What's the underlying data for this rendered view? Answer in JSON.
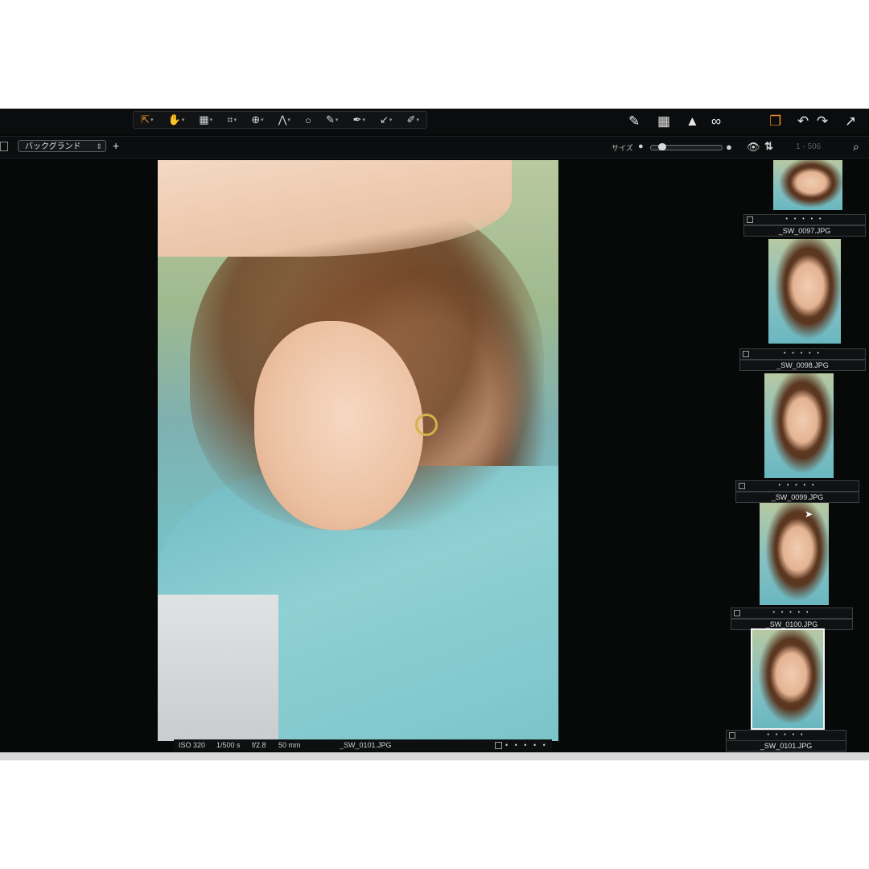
{
  "toolbar": {
    "tools": [
      {
        "name": "select-tool-icon",
        "glyph": "⇱",
        "active": true
      },
      {
        "name": "pan-tool-icon",
        "glyph": "✋"
      },
      {
        "name": "layer-tool-icon",
        "glyph": "▦"
      },
      {
        "name": "crop-tool-icon",
        "glyph": "⌗"
      },
      {
        "name": "rotate-tool-icon",
        "glyph": "⊕"
      },
      {
        "name": "keystone-tool-icon",
        "glyph": "⋀"
      },
      {
        "name": "spot-tool-icon",
        "glyph": "○",
        "nocaret": true
      },
      {
        "name": "brush-tool-icon",
        "glyph": "✎"
      },
      {
        "name": "picker-tool-icon",
        "glyph": "✒"
      },
      {
        "name": "arrow-tool-icon",
        "glyph": "↙"
      },
      {
        "name": "eraser-tool-icon",
        "glyph": "✐"
      }
    ],
    "right_icons": [
      "✎",
      "▦",
      "▲",
      "∞",
      "❐",
      "↶",
      "↷",
      "↗"
    ],
    "accent_color": "#f08a2e"
  },
  "subbar": {
    "dropdown_value": "バックグランド",
    "size_label": "サイズ",
    "range_label": "1 - 506",
    "slider_level": 0.12
  },
  "viewer": {
    "iso": "ISO 320",
    "shutter": "1/500 s",
    "aperture": "f/2.8",
    "focal": "50 mm",
    "filename": "_SW_0101.JPG",
    "rating_dots": "• • • • •"
  },
  "browser": {
    "thumbs": [
      {
        "name": "_SW_0097.JPG",
        "dots": "• • • • •"
      },
      {
        "name": "_SW_0098.JPG",
        "dots": "• • • • •"
      },
      {
        "name": "_SW_0099.JPG",
        "dots": "• • • • •"
      },
      {
        "name": "_SW_0100.JPG",
        "dots": "• • • • •"
      },
      {
        "name": "_SW_0101.JPG",
        "dots": "• • • • •",
        "selected": true
      }
    ]
  }
}
